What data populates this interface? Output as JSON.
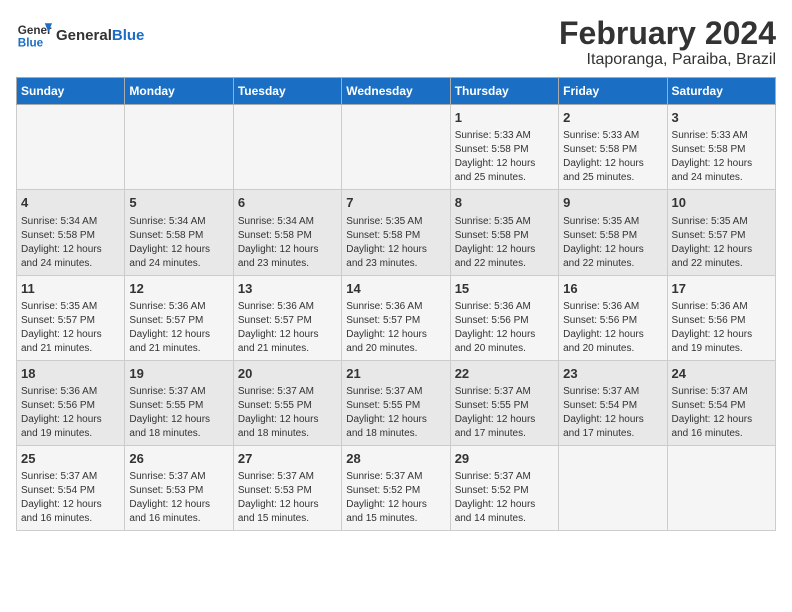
{
  "logo": {
    "general": "General",
    "blue": "Blue"
  },
  "title": "February 2024",
  "subtitle": "Itaporanga, Paraiba, Brazil",
  "days_of_week": [
    "Sunday",
    "Monday",
    "Tuesday",
    "Wednesday",
    "Thursday",
    "Friday",
    "Saturday"
  ],
  "weeks": [
    [
      {
        "day": "",
        "info": ""
      },
      {
        "day": "",
        "info": ""
      },
      {
        "day": "",
        "info": ""
      },
      {
        "day": "",
        "info": ""
      },
      {
        "day": "1",
        "info": "Sunrise: 5:33 AM\nSunset: 5:58 PM\nDaylight: 12 hours\nand 25 minutes."
      },
      {
        "day": "2",
        "info": "Sunrise: 5:33 AM\nSunset: 5:58 PM\nDaylight: 12 hours\nand 25 minutes."
      },
      {
        "day": "3",
        "info": "Sunrise: 5:33 AM\nSunset: 5:58 PM\nDaylight: 12 hours\nand 24 minutes."
      }
    ],
    [
      {
        "day": "4",
        "info": "Sunrise: 5:34 AM\nSunset: 5:58 PM\nDaylight: 12 hours\nand 24 minutes."
      },
      {
        "day": "5",
        "info": "Sunrise: 5:34 AM\nSunset: 5:58 PM\nDaylight: 12 hours\nand 24 minutes."
      },
      {
        "day": "6",
        "info": "Sunrise: 5:34 AM\nSunset: 5:58 PM\nDaylight: 12 hours\nand 23 minutes."
      },
      {
        "day": "7",
        "info": "Sunrise: 5:35 AM\nSunset: 5:58 PM\nDaylight: 12 hours\nand 23 minutes."
      },
      {
        "day": "8",
        "info": "Sunrise: 5:35 AM\nSunset: 5:58 PM\nDaylight: 12 hours\nand 22 minutes."
      },
      {
        "day": "9",
        "info": "Sunrise: 5:35 AM\nSunset: 5:58 PM\nDaylight: 12 hours\nand 22 minutes."
      },
      {
        "day": "10",
        "info": "Sunrise: 5:35 AM\nSunset: 5:57 PM\nDaylight: 12 hours\nand 22 minutes."
      }
    ],
    [
      {
        "day": "11",
        "info": "Sunrise: 5:35 AM\nSunset: 5:57 PM\nDaylight: 12 hours\nand 21 minutes."
      },
      {
        "day": "12",
        "info": "Sunrise: 5:36 AM\nSunset: 5:57 PM\nDaylight: 12 hours\nand 21 minutes."
      },
      {
        "day": "13",
        "info": "Sunrise: 5:36 AM\nSunset: 5:57 PM\nDaylight: 12 hours\nand 21 minutes."
      },
      {
        "day": "14",
        "info": "Sunrise: 5:36 AM\nSunset: 5:57 PM\nDaylight: 12 hours\nand 20 minutes."
      },
      {
        "day": "15",
        "info": "Sunrise: 5:36 AM\nSunset: 5:56 PM\nDaylight: 12 hours\nand 20 minutes."
      },
      {
        "day": "16",
        "info": "Sunrise: 5:36 AM\nSunset: 5:56 PM\nDaylight: 12 hours\nand 20 minutes."
      },
      {
        "day": "17",
        "info": "Sunrise: 5:36 AM\nSunset: 5:56 PM\nDaylight: 12 hours\nand 19 minutes."
      }
    ],
    [
      {
        "day": "18",
        "info": "Sunrise: 5:36 AM\nSunset: 5:56 PM\nDaylight: 12 hours\nand 19 minutes."
      },
      {
        "day": "19",
        "info": "Sunrise: 5:37 AM\nSunset: 5:55 PM\nDaylight: 12 hours\nand 18 minutes."
      },
      {
        "day": "20",
        "info": "Sunrise: 5:37 AM\nSunset: 5:55 PM\nDaylight: 12 hours\nand 18 minutes."
      },
      {
        "day": "21",
        "info": "Sunrise: 5:37 AM\nSunset: 5:55 PM\nDaylight: 12 hours\nand 18 minutes."
      },
      {
        "day": "22",
        "info": "Sunrise: 5:37 AM\nSunset: 5:55 PM\nDaylight: 12 hours\nand 17 minutes."
      },
      {
        "day": "23",
        "info": "Sunrise: 5:37 AM\nSunset: 5:54 PM\nDaylight: 12 hours\nand 17 minutes."
      },
      {
        "day": "24",
        "info": "Sunrise: 5:37 AM\nSunset: 5:54 PM\nDaylight: 12 hours\nand 16 minutes."
      }
    ],
    [
      {
        "day": "25",
        "info": "Sunrise: 5:37 AM\nSunset: 5:54 PM\nDaylight: 12 hours\nand 16 minutes."
      },
      {
        "day": "26",
        "info": "Sunrise: 5:37 AM\nSunset: 5:53 PM\nDaylight: 12 hours\nand 16 minutes."
      },
      {
        "day": "27",
        "info": "Sunrise: 5:37 AM\nSunset: 5:53 PM\nDaylight: 12 hours\nand 15 minutes."
      },
      {
        "day": "28",
        "info": "Sunrise: 5:37 AM\nSunset: 5:52 PM\nDaylight: 12 hours\nand 15 minutes."
      },
      {
        "day": "29",
        "info": "Sunrise: 5:37 AM\nSunset: 5:52 PM\nDaylight: 12 hours\nand 14 minutes."
      },
      {
        "day": "",
        "info": ""
      },
      {
        "day": "",
        "info": ""
      }
    ]
  ]
}
